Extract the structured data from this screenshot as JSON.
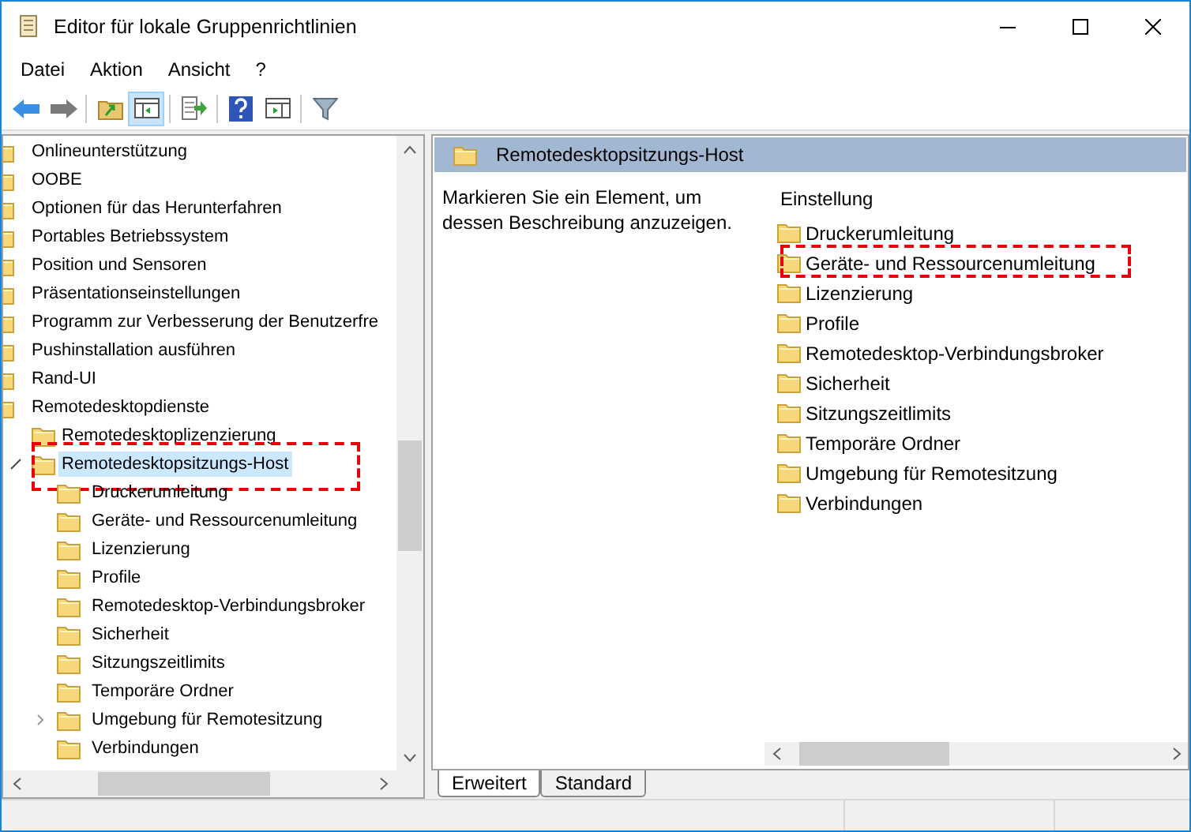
{
  "window": {
    "title": "Editor für lokale Gruppenrichtlinien"
  },
  "menu": [
    "Datei",
    "Aktion",
    "Ansicht",
    "?"
  ],
  "tree": [
    {
      "label": "Onlineunterstützung"
    },
    {
      "label": "OOBE"
    },
    {
      "label": "Optionen für das Herunterfahren"
    },
    {
      "label": "Portables Betriebssystem"
    },
    {
      "label": "Position und Sensoren"
    },
    {
      "label": "Präsentationseinstellungen"
    },
    {
      "label": "Programm zur Verbesserung der Benutzerfre"
    },
    {
      "label": "Pushinstallation ausführen"
    },
    {
      "label": "Rand-UI"
    },
    {
      "label": "Remotedesktopdienste",
      "children": [
        {
          "label": "Remotedesktoplizenzierung"
        },
        {
          "label": "Remotedesktopsitzungs-Host",
          "expanded": true,
          "selected": true,
          "annotated": true,
          "children": [
            {
              "label": "Druckerumleitung"
            },
            {
              "label": "Geräte- und Ressourcenumleitung"
            },
            {
              "label": "Lizenzierung"
            },
            {
              "label": "Profile"
            },
            {
              "label": "Remotedesktop-Verbindungsbroker"
            },
            {
              "label": "Sicherheit"
            },
            {
              "label": "Sitzungszeitlimits"
            },
            {
              "label": "Temporäre Ordner"
            },
            {
              "label": "Umgebung für Remotesitzung",
              "expanded": false
            },
            {
              "label": "Verbindungen"
            }
          ]
        }
      ]
    }
  ],
  "details": {
    "title": "Remotedesktopsitzungs-Host",
    "description": "Markieren Sie ein Element, um dessen Beschreibung anzuzeigen.",
    "column": "Einstellung",
    "items": [
      {
        "label": "Druckerumleitung",
        "annotated": false
      },
      {
        "label": "Geräte- und Ressourcenumleitung",
        "annotated": true
      },
      {
        "label": "Lizenzierung",
        "annotated": false
      },
      {
        "label": "Profile",
        "annotated": false
      },
      {
        "label": "Remotedesktop-Verbindungsbroker",
        "annotated": false
      },
      {
        "label": "Sicherheit",
        "annotated": false
      },
      {
        "label": "Sitzungszeitlimits",
        "annotated": false
      },
      {
        "label": "Temporäre Ordner",
        "annotated": false
      },
      {
        "label": "Umgebung für Remotesitzung",
        "annotated": false
      },
      {
        "label": "Verbindungen",
        "annotated": false
      }
    ]
  },
  "tabs": [
    {
      "label": "Erweitert",
      "selected": true
    },
    {
      "label": "Standard",
      "selected": false
    }
  ]
}
